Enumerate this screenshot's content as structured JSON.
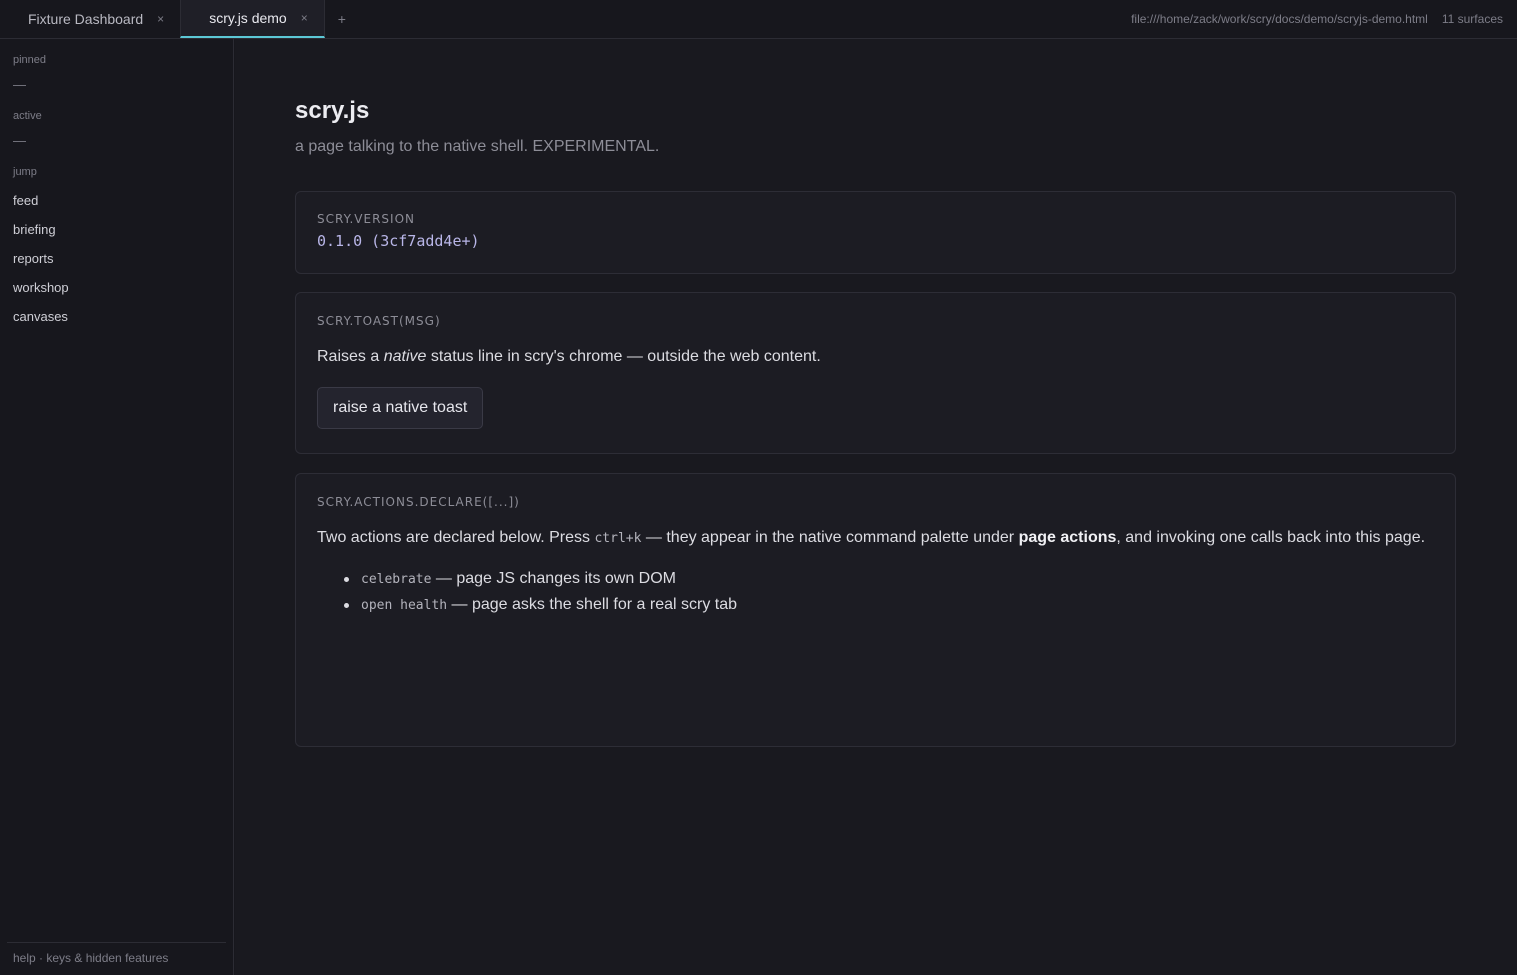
{
  "tabs": [
    {
      "label": "Fixture Dashboard",
      "close": "×",
      "active": false
    },
    {
      "label": "scry.js demo",
      "close": "×",
      "active": true
    }
  ],
  "tab_add": "+",
  "topbar": {
    "path": "file:///home/zack/work/scry/docs/demo/scryjs-demo.html",
    "surfaces": "11 surfaces"
  },
  "sidebar": {
    "pinned_label": "pinned",
    "pinned_empty": "—",
    "active_label": "active",
    "active_empty": "—",
    "jump_label": "jump",
    "jump_items": [
      "feed",
      "briefing",
      "reports",
      "workshop",
      "canvases"
    ],
    "footer": "help · keys & hidden features"
  },
  "page": {
    "title": "scry.js",
    "subtitle": "a page talking to the native shell. EXPERIMENTAL."
  },
  "version_card": {
    "label": "SCRY.VERSION",
    "value": "0.1.0 (3cf7add4e+)"
  },
  "toast_card": {
    "label": "SCRY.TOAST(MSG)",
    "text_before": "Raises a ",
    "text_em": "native",
    "text_after": " status line in scry's chrome — outside the web content.",
    "button": "raise a native toast"
  },
  "actions_card": {
    "label": "SCRY.ACTIONS.DECLARE([...])",
    "text_1": "Two actions are declared below. Press ",
    "text_code": "ctrl+k",
    "text_2": " — they appear in the native command palette under ",
    "text_bold": "page actions",
    "text_3": ", and invoking one calls back into this page.",
    "items": [
      {
        "code": "celebrate",
        "desc": " — page JS changes its own DOM"
      },
      {
        "code": "open health",
        "desc": " — page asks the shell for a real scry tab"
      }
    ]
  },
  "colors": {
    "accent": "#5cc8d6",
    "background": "#19191f",
    "card": "#1c1c23",
    "version_text": "#b9b6e8"
  }
}
